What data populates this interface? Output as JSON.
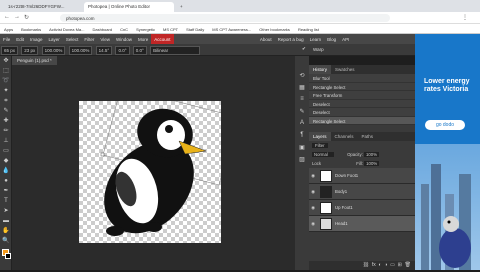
{
  "browser": {
    "tabs": [
      {
        "label": "1s-r22t8-7ml26DDFYGFW..."
      },
      {
        "label": "Photopea | Online Photo Editor"
      }
    ],
    "url": "photopea.com",
    "bookmarks": [
      "Apps",
      "Bookmarks",
      "Activist Dovea Ma...",
      "Dashboard",
      "CnC",
      "Synergetic",
      "MS CPT",
      "Staff Daily",
      "MS CPT Awareness...",
      "Other bookmarks",
      "Reading list"
    ]
  },
  "menubar": {
    "items": [
      "File",
      "Edit",
      "Image",
      "Layer",
      "Select",
      "Filter",
      "View",
      "Window",
      "More"
    ],
    "account": "Account",
    "right_items": [
      "About",
      "Report a bug",
      "Learn",
      "Blog",
      "API"
    ]
  },
  "options": {
    "x": "65 px",
    "y": "23 px",
    "w": "100.00%",
    "h": "100.00%",
    "angle": "14.5°",
    "skew_h": "0.0°",
    "skew_v": "0.0°",
    "interp": "Bilinear",
    "warp": "Warp"
  },
  "document": {
    "tab_label": "Penguin (1).psd *"
  },
  "history": {
    "tabs": [
      "History",
      "Swatches"
    ],
    "items": [
      "Blur Tool",
      "Rectangle Select",
      "Free Transform",
      "Deselect",
      "Deselect",
      "Rectangle Select"
    ],
    "selected_index": 5
  },
  "layers": {
    "tabs": [
      "Layers",
      "Channels",
      "Paths"
    ],
    "filter_label": "Filter",
    "blend_mode": "Normal",
    "opacity_label": "Opacity:",
    "opacity": "100%",
    "lock_label": "Lock",
    "fill_label": "Fill:",
    "fill": "100%",
    "items": [
      "Down Foot1",
      "Body1",
      "Up Foot1",
      "Head1"
    ]
  },
  "ad": {
    "headline": "Lower energy rates Victoria",
    "button": "go dodo"
  },
  "colors": {
    "accent": "#c02626",
    "ad_bg": "#1877c9",
    "ui_bg": "#3a3a3a"
  }
}
